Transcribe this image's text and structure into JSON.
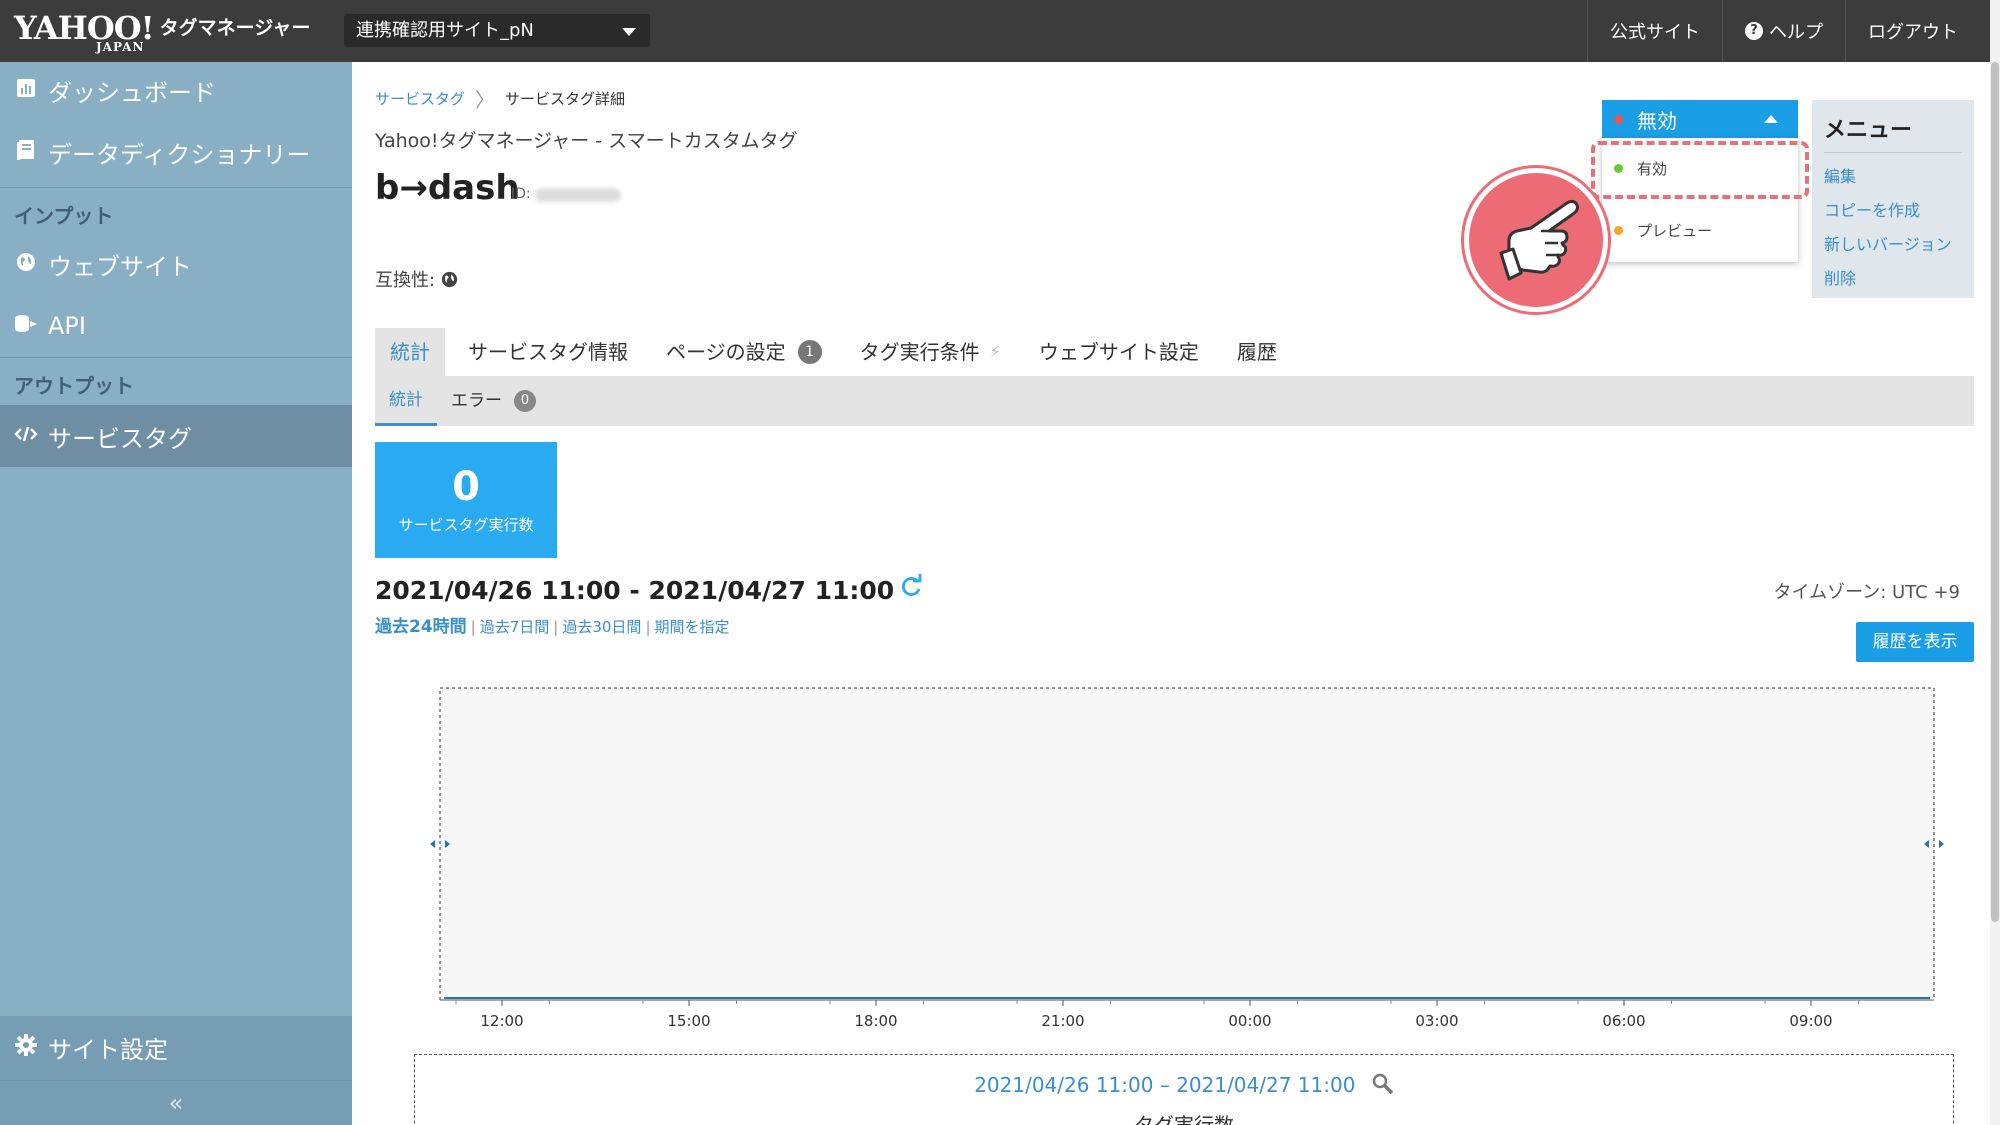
{
  "header": {
    "logo_text": "YAHOO!",
    "logo_sub": "JAPAN",
    "product": "タグマネージャー",
    "site_select": "連携確認用サイト_pN",
    "nav": [
      "公式サイト",
      "ヘルプ",
      "ログアウト"
    ]
  },
  "sidebar": {
    "dashboard": "ダッシュボード",
    "dictionary": "データディクショナリー",
    "input_head": "インプット",
    "website": "ウェブサイト",
    "api": "API",
    "output_head": "アウトプット",
    "service_tag": "サービスタグ",
    "site_settings": "サイト設定",
    "collapse": "«"
  },
  "breadcrumb": {
    "link": "サービスタグ",
    "current": "サービスタグ詳細"
  },
  "page": {
    "subtitle": "Yahoo!タグマネージャー - スマートカスタムタグ",
    "tag_name": "b→dash",
    "id_label": "ID:",
    "compat_label": "互換性:"
  },
  "status": {
    "current": "無効",
    "options": [
      "有効",
      "プレビュー"
    ],
    "colors": {
      "disabled": "#ef5350",
      "enabled": "#66cc33",
      "preview": "#f5a623"
    }
  },
  "menu": {
    "title": "メニュー",
    "items": [
      "編集",
      "コピーを作成",
      "新しいバージョン",
      "削除"
    ]
  },
  "tabs": [
    {
      "label": "統計"
    },
    {
      "label": "サービスタグ情報"
    },
    {
      "label": "ページの設定",
      "badge": "1"
    },
    {
      "label": "タグ実行条件"
    },
    {
      "label": "ウェブサイト設定"
    },
    {
      "label": "履歴"
    }
  ],
  "subtabs": [
    {
      "label": "統計"
    },
    {
      "label": "エラー",
      "badge": "0"
    }
  ],
  "stat": {
    "value": "0",
    "label": "サービスタグ実行数"
  },
  "range": {
    "text": "2021/04/26 11:00 - 2021/04/27 11:00",
    "periods": [
      "過去24時間",
      "過去7日間",
      "過去30日間",
      "期間を指定"
    ],
    "timezone": "タイムゾーン: UTC +9",
    "history_button": "履歴を表示"
  },
  "chart_data": {
    "type": "line",
    "x": [
      "12:00",
      "15:00",
      "18:00",
      "21:00",
      "00:00",
      "03:00",
      "06:00",
      "09:00"
    ],
    "series": [
      {
        "values": [
          0,
          0,
          0,
          0,
          0,
          0,
          0,
          0
        ]
      }
    ]
  },
  "lower": {
    "range": "2021/04/26 11:00 – 2021/04/27 11:00",
    "label": "タグ実行数"
  }
}
